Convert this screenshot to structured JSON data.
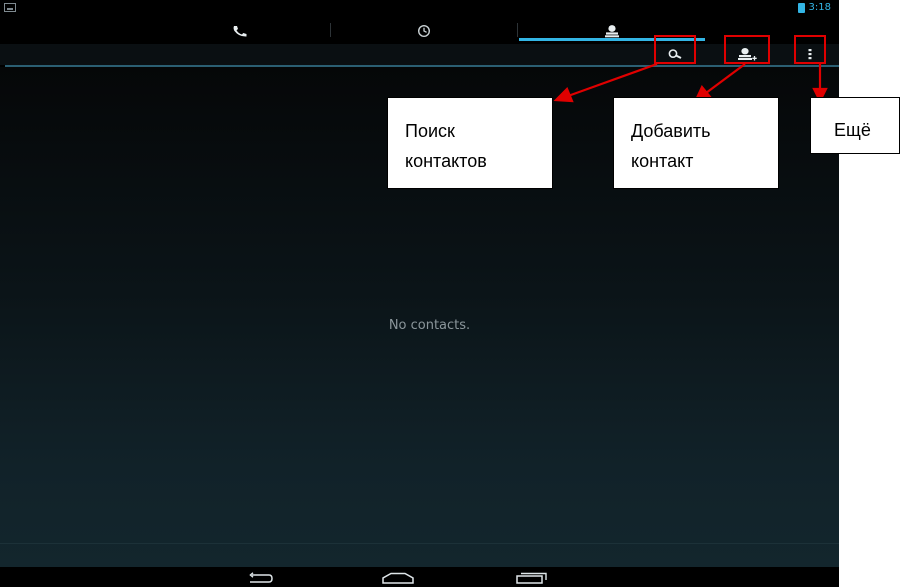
{
  "status_bar": {
    "time": "3:18"
  },
  "tabs": [
    {
      "icon": "phone-icon",
      "selected": false
    },
    {
      "icon": "clock-icon",
      "selected": false
    },
    {
      "icon": "contacts-icon",
      "selected": true
    }
  ],
  "action_bar": {
    "actions": [
      {
        "icon": "search-icon"
      },
      {
        "icon": "add-contact-icon"
      },
      {
        "icon": "overflow-menu-icon"
      }
    ]
  },
  "main": {
    "empty_text": "No contacts."
  },
  "annotations": {
    "search": {
      "line1": "Поиск",
      "line2": "контактов"
    },
    "add_contact": {
      "line1": "Добавить",
      "line2": "контакт"
    },
    "more": {
      "line1": "Ещё"
    }
  },
  "colors": {
    "accent": "#33b5e5",
    "highlight": "#e00000"
  }
}
